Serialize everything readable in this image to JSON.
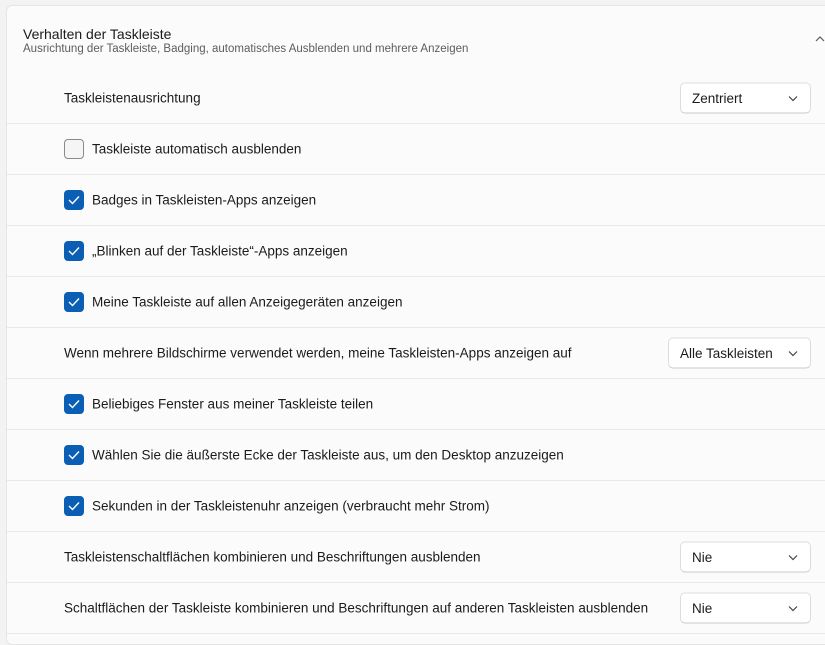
{
  "section": {
    "title": "Verhalten der Taskleiste",
    "subtitle": "Ausrichtung der Taskleiste, Badging, automatisches Ausblenden und mehrere Anzeigen"
  },
  "alignment": {
    "label": "Taskleistenausrichtung",
    "value": "Zentriert"
  },
  "auto_hide": {
    "label": "Taskleiste automatisch ausblenden",
    "checked": false
  },
  "badges": {
    "label": "Badges in Taskleisten-Apps anzeigen",
    "checked": true
  },
  "flashing": {
    "label": "„Blinken auf der Taskleiste“-Apps anzeigen",
    "checked": true
  },
  "all_displays": {
    "label": "Meine Taskleiste auf allen Anzeigegeräten anzeigen",
    "checked": true
  },
  "multi_display": {
    "label": "Wenn mehrere Bildschirme verwendet werden, meine Taskleisten-Apps anzeigen auf",
    "value": "Alle Taskleisten"
  },
  "share_window": {
    "label": "Beliebiges Fenster aus meiner Taskleiste teilen",
    "checked": true
  },
  "far_corner": {
    "label": "Wählen Sie die äußerste Ecke der Taskleiste aus, um den Desktop anzuzeigen",
    "checked": true
  },
  "seconds": {
    "label": "Sekunden in der Taskleistenuhr anzeigen (verbraucht mehr Strom)",
    "checked": true
  },
  "combine_buttons": {
    "label": "Taskleistenschaltflächen kombinieren und Beschriftungen ausblenden",
    "value": "Nie"
  },
  "combine_other": {
    "label": "Schaltflächen der Taskleiste kombinieren und Beschriftungen auf anderen Taskleisten ausblenden",
    "value": "Nie"
  },
  "colors": {
    "accent": "#0a5fb4"
  }
}
